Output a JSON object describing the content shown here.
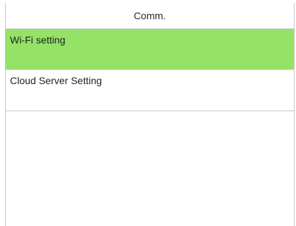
{
  "header": {
    "title": "Comm."
  },
  "menu": {
    "items": [
      {
        "label": "Wi-Fi setting",
        "selected": true
      },
      {
        "label": "Cloud Server Setting",
        "selected": false
      }
    ]
  },
  "colors": {
    "selected_background": "#94e367",
    "divider": "#c9c9c9",
    "background": "#ffffff"
  }
}
